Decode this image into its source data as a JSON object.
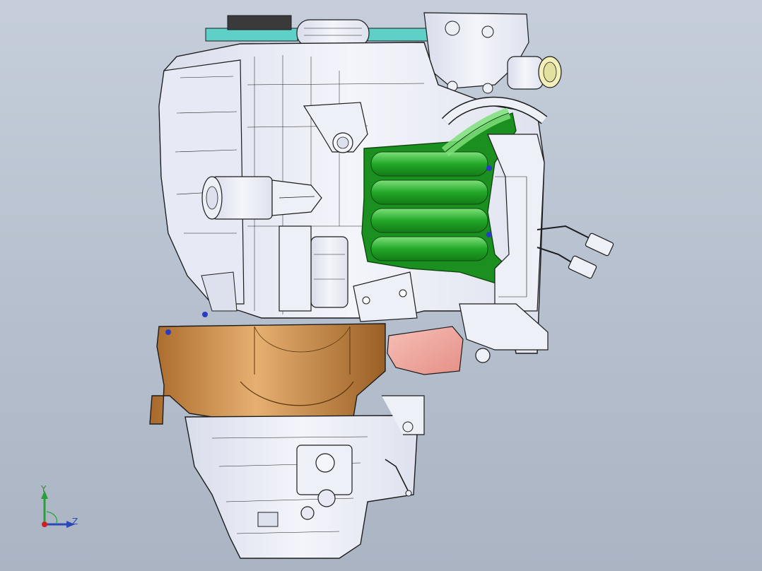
{
  "viewport": {
    "background_top": "#c6cedb",
    "background_bottom": "#aab4c3"
  },
  "model": {
    "subject": "engine-assembly",
    "colors": {
      "outline": "#1c1c1c",
      "body": "#eef0f8",
      "body_shade": "#d7dbea",
      "belt": "#5fd0c8",
      "intake_manifold": "#1fa024",
      "intake_highlight": "#7ee07a",
      "bellhousing": "#c98a45",
      "bellhousing_shade": "#9a5f25",
      "exhaust_pipe": "#f0a8a0",
      "fastener_blue": "#2a3cc0"
    }
  },
  "triad": {
    "y_label": "Y",
    "z_label": "Z",
    "y_color": "#27a03a",
    "z_color": "#2b48b8",
    "origin_color": "#d02020"
  }
}
